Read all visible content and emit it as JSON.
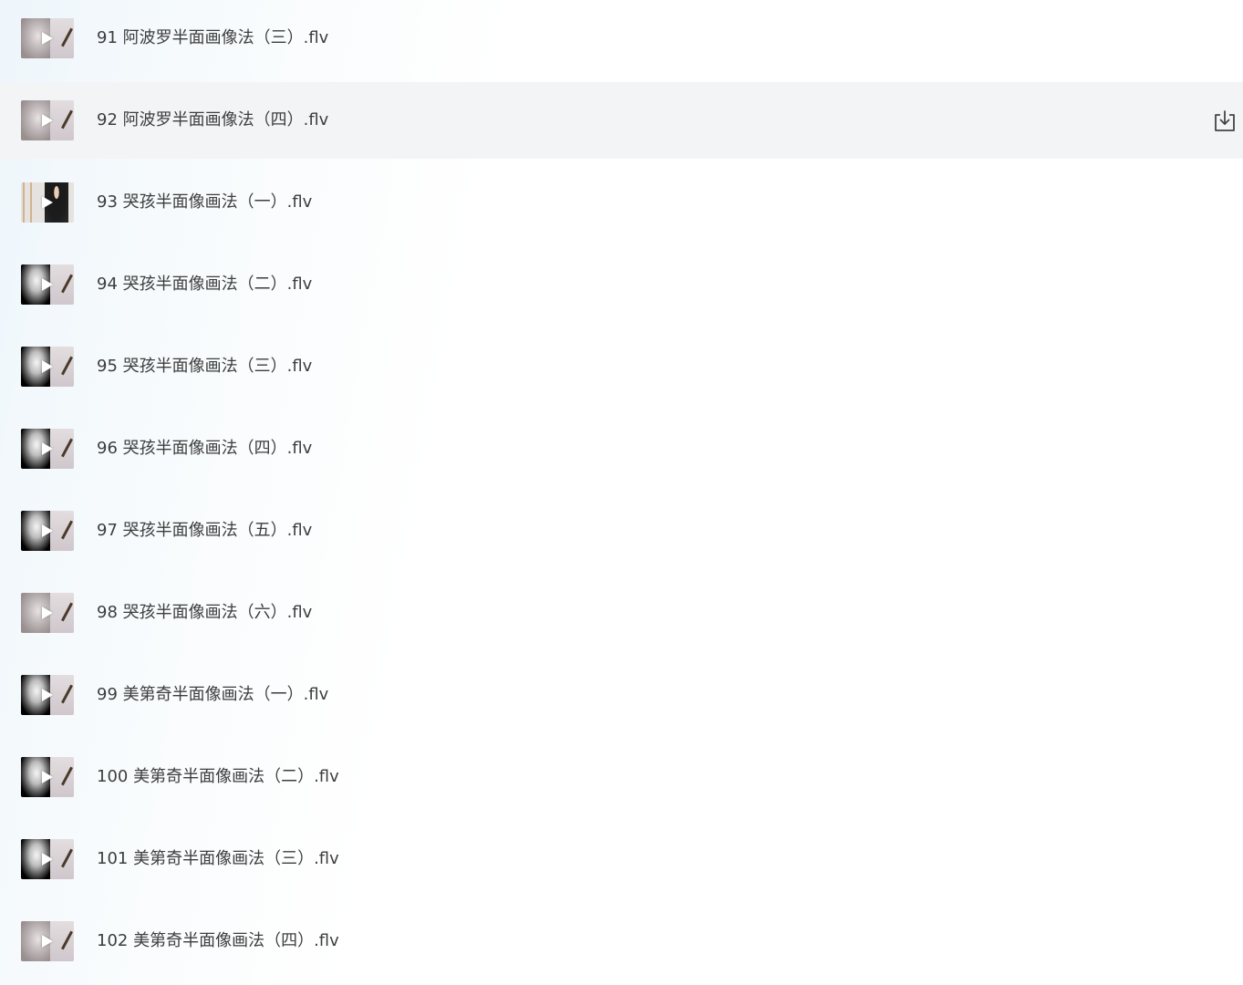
{
  "files": [
    {
      "name": "91 阿波罗半面画像法（三）.flv",
      "thumb": "warm"
    },
    {
      "name": "92 阿波罗半面画像法（四）.flv",
      "thumb": "warm"
    },
    {
      "name": "93 哭孩半面像画法（一）.flv",
      "thumb": "person"
    },
    {
      "name": "94 哭孩半面像画法（二）.flv",
      "thumb": "dark"
    },
    {
      "name": "95 哭孩半面像画法（三）.flv",
      "thumb": "dark"
    },
    {
      "name": "96 哭孩半面像画法（四）.flv",
      "thumb": "dark"
    },
    {
      "name": "97 哭孩半面像画法（五）.flv",
      "thumb": "dark"
    },
    {
      "name": "98 哭孩半面像画法（六）.flv",
      "thumb": "warm"
    },
    {
      "name": "99 美第奇半面像画法（一）.flv",
      "thumb": "dark"
    },
    {
      "name": "100 美第奇半面像画法（二）.flv",
      "thumb": "dark"
    },
    {
      "name": "101 美第奇半面像画法（三）.flv",
      "thumb": "dark"
    },
    {
      "name": "102 美第奇半面像画法（四）.flv",
      "thumb": "warm"
    }
  ],
  "hovered_row": 1,
  "icons": {
    "thumbnail_overlay": "play-icon",
    "row_action": "download-icon"
  },
  "colors": {
    "row_hover_bg": "#f3f4f6",
    "text": "#3d3d3d"
  }
}
